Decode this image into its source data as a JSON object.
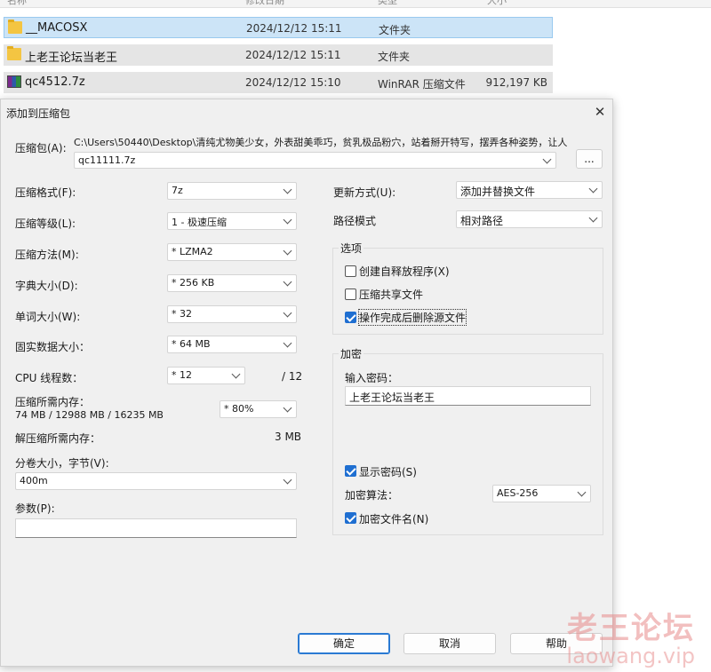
{
  "explorer": {
    "columns": [
      "名称",
      "修改日期",
      "类型",
      "大小"
    ],
    "rows": [
      {
        "name": "__MACOSX",
        "date": "2024/12/12 15:11",
        "type": "文件夹",
        "size": "",
        "icon": "folder-icon"
      },
      {
        "name": "上老王论坛当老王",
        "date": "2024/12/12 15:11",
        "type": "文件夹",
        "size": "",
        "icon": "folder-icon"
      },
      {
        "name": "qc4512.7z",
        "date": "2024/12/12 15:10",
        "type": "WinRAR 压缩文件",
        "size": "912,197 KB",
        "icon": "winrar-archive-icon"
      }
    ]
  },
  "dialog": {
    "title": "添加到压缩包",
    "close_icon": "close-icon",
    "archive_label": "压缩包(A):",
    "archive_path": "C:\\Users\\50440\\Desktop\\清纯尤物美少女，外表甜美乖巧，贫乳极品粉穴，站着掰开特写，摆弄各种姿势，让人",
    "archive_name": "qc11111.7z",
    "browse_label": "...",
    "format_label": "压缩格式(F):",
    "format_value": "7z",
    "level_label": "压缩等级(L):",
    "level_value": "1 - 极速压缩",
    "method_label": "压缩方法(M):",
    "method_value": "* LZMA2",
    "dict_label": "字典大小(D):",
    "dict_value": "* 256 KB",
    "word_label": "单词大小(W):",
    "word_value": "* 32",
    "solid_label": "固实数据大小：",
    "solid_value": "* 64 MB",
    "cpu_label": "CPU 线程数：",
    "cpu_value": "* 12",
    "cpu_max": "/ 12",
    "mem_label": "压缩所需内存：",
    "mem_detail": "74 MB / 12988 MB / 16235 MB",
    "mem_value": "* 80%",
    "decomp_label": "解压缩所需内存：",
    "decomp_value": "3 MB",
    "split_label": "分卷大小，字节(V):",
    "split_value": "400m",
    "params_label": "参数(P):",
    "params_value": "",
    "update_label": "更新方式(U):",
    "update_value": "添加并替换文件",
    "pathmode_label": "路径模式",
    "pathmode_value": "相对路径",
    "options_title": "选项",
    "options": [
      {
        "label": "创建自释放程序(X)",
        "checked": false
      },
      {
        "label": "压缩共享文件",
        "checked": false
      },
      {
        "label": "操作完成后删除源文件",
        "checked": true
      }
    ],
    "encrypt_title": "加密",
    "password_label": "输入密码：",
    "password_value": "上老王论坛当老王",
    "show_password_label": "显示密码(S)",
    "show_password_checked": true,
    "enc_method_label": "加密算法：",
    "enc_method_value": "AES-256",
    "encrypt_names_label": "加密文件名(N)",
    "encrypt_names_checked": true,
    "ok_label": "确定",
    "cancel_label": "取消",
    "help_label": "帮助"
  },
  "watermark": {
    "line1": "老王论坛",
    "line2": "laowang.vip"
  }
}
